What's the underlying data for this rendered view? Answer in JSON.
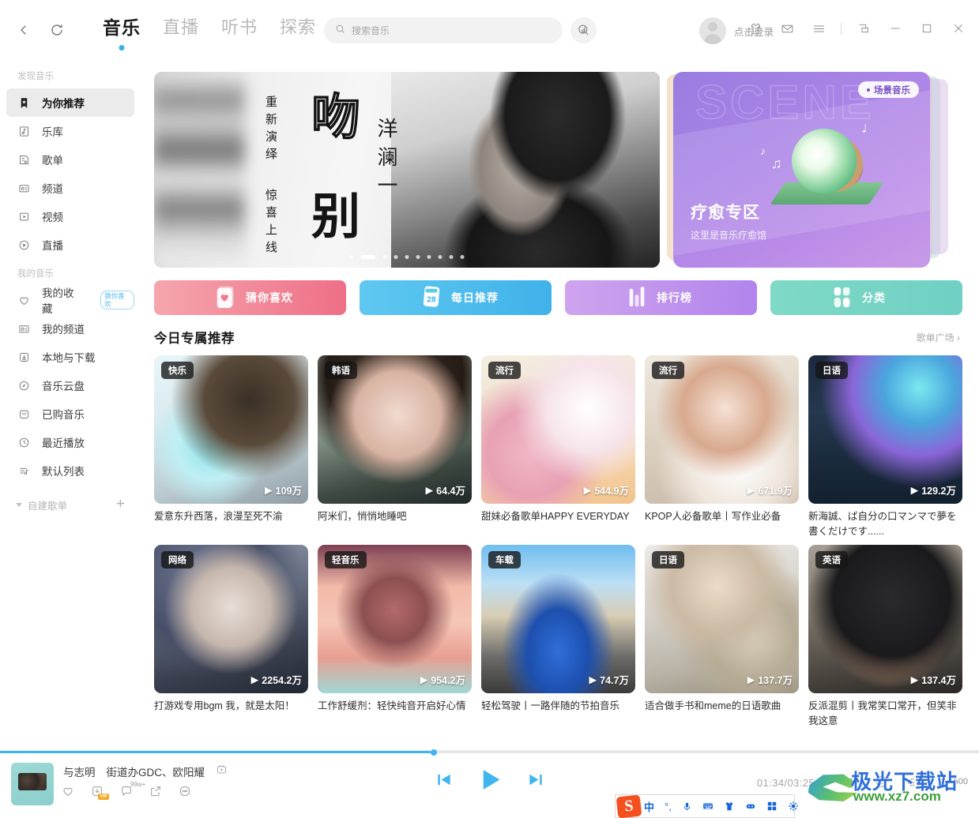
{
  "header": {
    "back_icon": "chevron-left-icon",
    "refresh_icon": "refresh-icon",
    "tabs": [
      {
        "label": "音乐",
        "active": true
      },
      {
        "label": "直播",
        "active": false
      },
      {
        "label": "听书",
        "active": false
      },
      {
        "label": "探索",
        "active": false
      }
    ],
    "search": {
      "placeholder": "搜索音乐",
      "icon": "search-icon"
    },
    "mic_icon": "voice-search-icon",
    "login_text": "点击登录",
    "window_icons": [
      "shirt-icon",
      "mail-icon",
      "menu-icon",
      "mini-window-icon",
      "minimize-icon",
      "maximize-icon",
      "close-icon"
    ]
  },
  "sidebar": {
    "group1_title": "发现音乐",
    "group1": [
      {
        "label": "为你推荐",
        "icon": "bookmark-star-icon",
        "active": true
      },
      {
        "label": "乐库",
        "icon": "music-library-icon",
        "active": false
      },
      {
        "label": "歌单",
        "icon": "playlist-icon",
        "active": false
      },
      {
        "label": "频道",
        "icon": "radio-icon",
        "active": false
      },
      {
        "label": "视频",
        "icon": "video-icon",
        "active": false
      },
      {
        "label": "直播",
        "icon": "live-icon",
        "active": false
      }
    ],
    "group2_title": "我的音乐",
    "group2": [
      {
        "label": "我的收藏",
        "icon": "heart-icon",
        "badge": "猜你喜欢"
      },
      {
        "label": "我的频道",
        "icon": "radio-icon",
        "badge": ""
      },
      {
        "label": "本地与下载",
        "icon": "download-icon",
        "badge": ""
      },
      {
        "label": "音乐云盘",
        "icon": "cloud-icon",
        "badge": ""
      },
      {
        "label": "已购音乐",
        "icon": "purchased-icon",
        "badge": ""
      },
      {
        "label": "最近播放",
        "icon": "clock-icon",
        "badge": ""
      },
      {
        "label": "默认列表",
        "icon": "list-music-icon",
        "badge": ""
      }
    ],
    "custom_playlists_label": "自建歌单",
    "add_playlist_icon": "plus-icon"
  },
  "banner": {
    "main": {
      "vertical_left": "重新演绎",
      "vertical_left2": "惊喜上线",
      "big_char_1": "吻",
      "big_char_2": "别",
      "artist": "洋澜一",
      "dots_total": 10,
      "dot_active_index": 1
    },
    "side": {
      "ghost_text": "SCENE",
      "pill": "场景音乐",
      "title": "疗愈专区",
      "subtitle": "这里是音乐疗愈馆"
    }
  },
  "quick_actions": [
    {
      "label": "猜你喜欢",
      "icon": "heart-card-icon",
      "color": "#ee6f87"
    },
    {
      "label": "每日推荐",
      "icon": "calendar-28-icon",
      "color": "#3fb2ea",
      "day": "28"
    },
    {
      "label": "排行榜",
      "icon": "bar-chart-icon",
      "color": "#b184ec"
    },
    {
      "label": "分类",
      "icon": "grid-icon",
      "color": "#6fd0c3"
    }
  ],
  "section": {
    "title": "今日专属推荐",
    "more_label": "歌单广场",
    "more_icon": "chevron-right-icon"
  },
  "cards": [
    {
      "tag": "快乐",
      "plays": "109万",
      "title": "爱意东升西落，浪漫至死不渝",
      "art": "art1"
    },
    {
      "tag": "韩语",
      "plays": "64.4万",
      "title": "阿米们，悄悄地睡吧",
      "art": "art2"
    },
    {
      "tag": "流行",
      "plays": "544.9万",
      "title": "甜妹必备歌单HAPPY EVERYDAY",
      "art": "art3"
    },
    {
      "tag": "流行",
      "plays": "671.9万",
      "title": "KPOP人必备歌单丨写作业必备",
      "art": "art4"
    },
    {
      "tag": "日语",
      "plays": "129.2万",
      "title": "新海誠、ば自分の口マンマで夢を書くだけです......",
      "art": "art5"
    },
    {
      "tag": "网络",
      "plays": "2254.2万",
      "title": "打游戏专用bgm 我，就是太阳！",
      "art": "art6"
    },
    {
      "tag": "轻音乐",
      "plays": "954.2万",
      "title": "工作舒缓剂：轻快纯音开启好心情",
      "art": "art7"
    },
    {
      "tag": "车载",
      "plays": "74.7万",
      "title": "轻松驾驶丨一路伴随的节拍音乐",
      "art": "art8"
    },
    {
      "tag": "日语",
      "plays": "137.7万",
      "title": "适合做手书和meme的日语歌曲",
      "art": "art9"
    },
    {
      "tag": "英语",
      "plays": "137.4万",
      "title": "反派混剪丨我常笑口常开，但笑非我这意",
      "art": "art10"
    }
  ],
  "player": {
    "progress_percent": 44,
    "song_name": "与志明",
    "song_artist": "街道办GDC、欧阳耀",
    "mv_icon": "mv-icon",
    "actions": [
      {
        "icon": "heart-icon",
        "label": ""
      },
      {
        "icon": "download-vip-icon",
        "label": "VIP"
      },
      {
        "icon": "comment-icon",
        "label": "99w+"
      },
      {
        "icon": "share-icon",
        "label": ""
      },
      {
        "icon": "more-icon",
        "label": ""
      }
    ],
    "prev_icon": "previous-icon",
    "play_icon": "play-icon",
    "next_icon": "next-icon",
    "time": "01:34/03:25",
    "volume_icon": "volume-icon",
    "loop_icon": "loop-one-icon",
    "lyrics_icon": "lyrics-icon",
    "queue_icon": "queue-icon",
    "queue_count": "500"
  },
  "watermark": {
    "cn": "极光下载站",
    "url": "www.xz7.com"
  },
  "ime": {
    "logo": "S",
    "items": [
      "中",
      "°,",
      "mic-icon",
      "keyboard-icon",
      "shirt-icon",
      "robot-icon",
      "apps-icon",
      "settings-icon"
    ]
  }
}
